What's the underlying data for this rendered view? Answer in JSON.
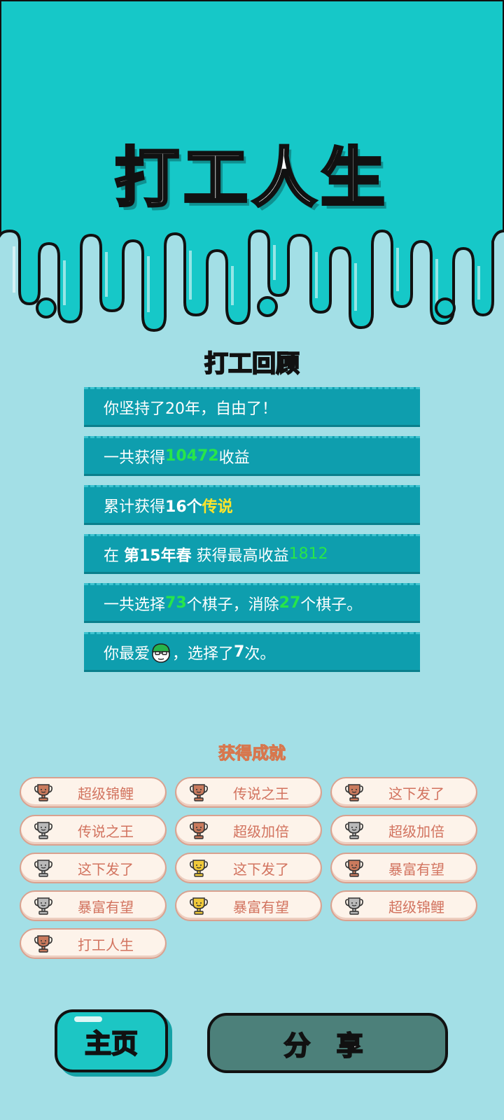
{
  "app_title": "打工人生",
  "review": {
    "title": "打工回顾",
    "rows": [
      {
        "parts": [
          "你坚持了20年，自由了！"
        ]
      },
      {
        "parts": [
          "一共获得",
          "10472",
          "收益"
        ]
      },
      {
        "parts": [
          "累计获得",
          "16个",
          "传说"
        ]
      },
      {
        "parts": [
          "在 ",
          "第15年春",
          " 获得最高收益",
          "1812"
        ]
      },
      {
        "parts": [
          "一共选择",
          "73",
          "个棋子，消除",
          "27",
          "个棋子。"
        ]
      },
      {
        "parts": [
          "你最爱",
          "，选择了",
          "7",
          "次。"
        ]
      }
    ]
  },
  "achievements": {
    "title": "获得成就",
    "items": [
      {
        "label": "超级锦鲤",
        "tier": "bronze"
      },
      {
        "label": "传说之王",
        "tier": "bronze"
      },
      {
        "label": "这下发了",
        "tier": "bronze"
      },
      {
        "label": "传说之王",
        "tier": "silver"
      },
      {
        "label": "超级加倍",
        "tier": "bronze"
      },
      {
        "label": "超级加倍",
        "tier": "silver"
      },
      {
        "label": "这下发了",
        "tier": "silver"
      },
      {
        "label": "这下发了",
        "tier": "gold"
      },
      {
        "label": "暴富有望",
        "tier": "bronze"
      },
      {
        "label": "暴富有望",
        "tier": "silver"
      },
      {
        "label": "暴富有望",
        "tier": "gold"
      },
      {
        "label": "超级锦鲤",
        "tier": "silver"
      },
      {
        "label": "打工人生",
        "tier": "bronze"
      }
    ]
  },
  "buttons": {
    "home": "主页",
    "share": "分 享"
  },
  "colors": {
    "header_bg": "#16c8c8",
    "page_bg": "#a3dfe6",
    "row_bg": "#0e9eae",
    "highlight_green": "#27e64a",
    "highlight_yellow": "#ffe42a",
    "trophy_bronze": "#c97a5d",
    "trophy_silver": "#b9b9b9",
    "trophy_gold": "#f0c93a"
  },
  "icons": {
    "favorite": "green-cap-character-icon",
    "trophy": "trophy-icon"
  }
}
